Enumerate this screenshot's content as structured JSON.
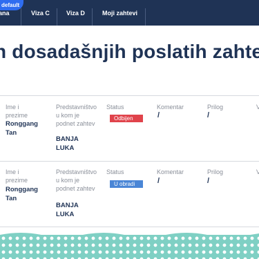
{
  "pill": {
    "label": "default"
  },
  "nav": {
    "items": [
      "ana",
      "Viza C",
      "Viza D",
      "Moji zahtevi"
    ]
  },
  "page": {
    "title": "n dosadašnjih poslatih zahte"
  },
  "columns": {
    "name": "Ime i prezime",
    "office": "Predstavništvo u kom je podnet zahtev",
    "status": "Status",
    "comment": "Komentar",
    "attachment": "Prilog",
    "extra": "V"
  },
  "rows": [
    {
      "name": "Ronggang Tan",
      "office": "BANJA LUKA",
      "status": "Odbijen",
      "status_color": "#e0434b",
      "comment": "/",
      "attachment": "/"
    },
    {
      "name": "Ronggang Tan",
      "office": "BANJA LUKA",
      "status": "U obradi",
      "status_color": "#4a86d6",
      "comment": "/",
      "attachment": "/"
    }
  ],
  "colors": {
    "navbar": "#1f3355",
    "accent": "#2f6df0",
    "footer": "#7fd0c4"
  }
}
